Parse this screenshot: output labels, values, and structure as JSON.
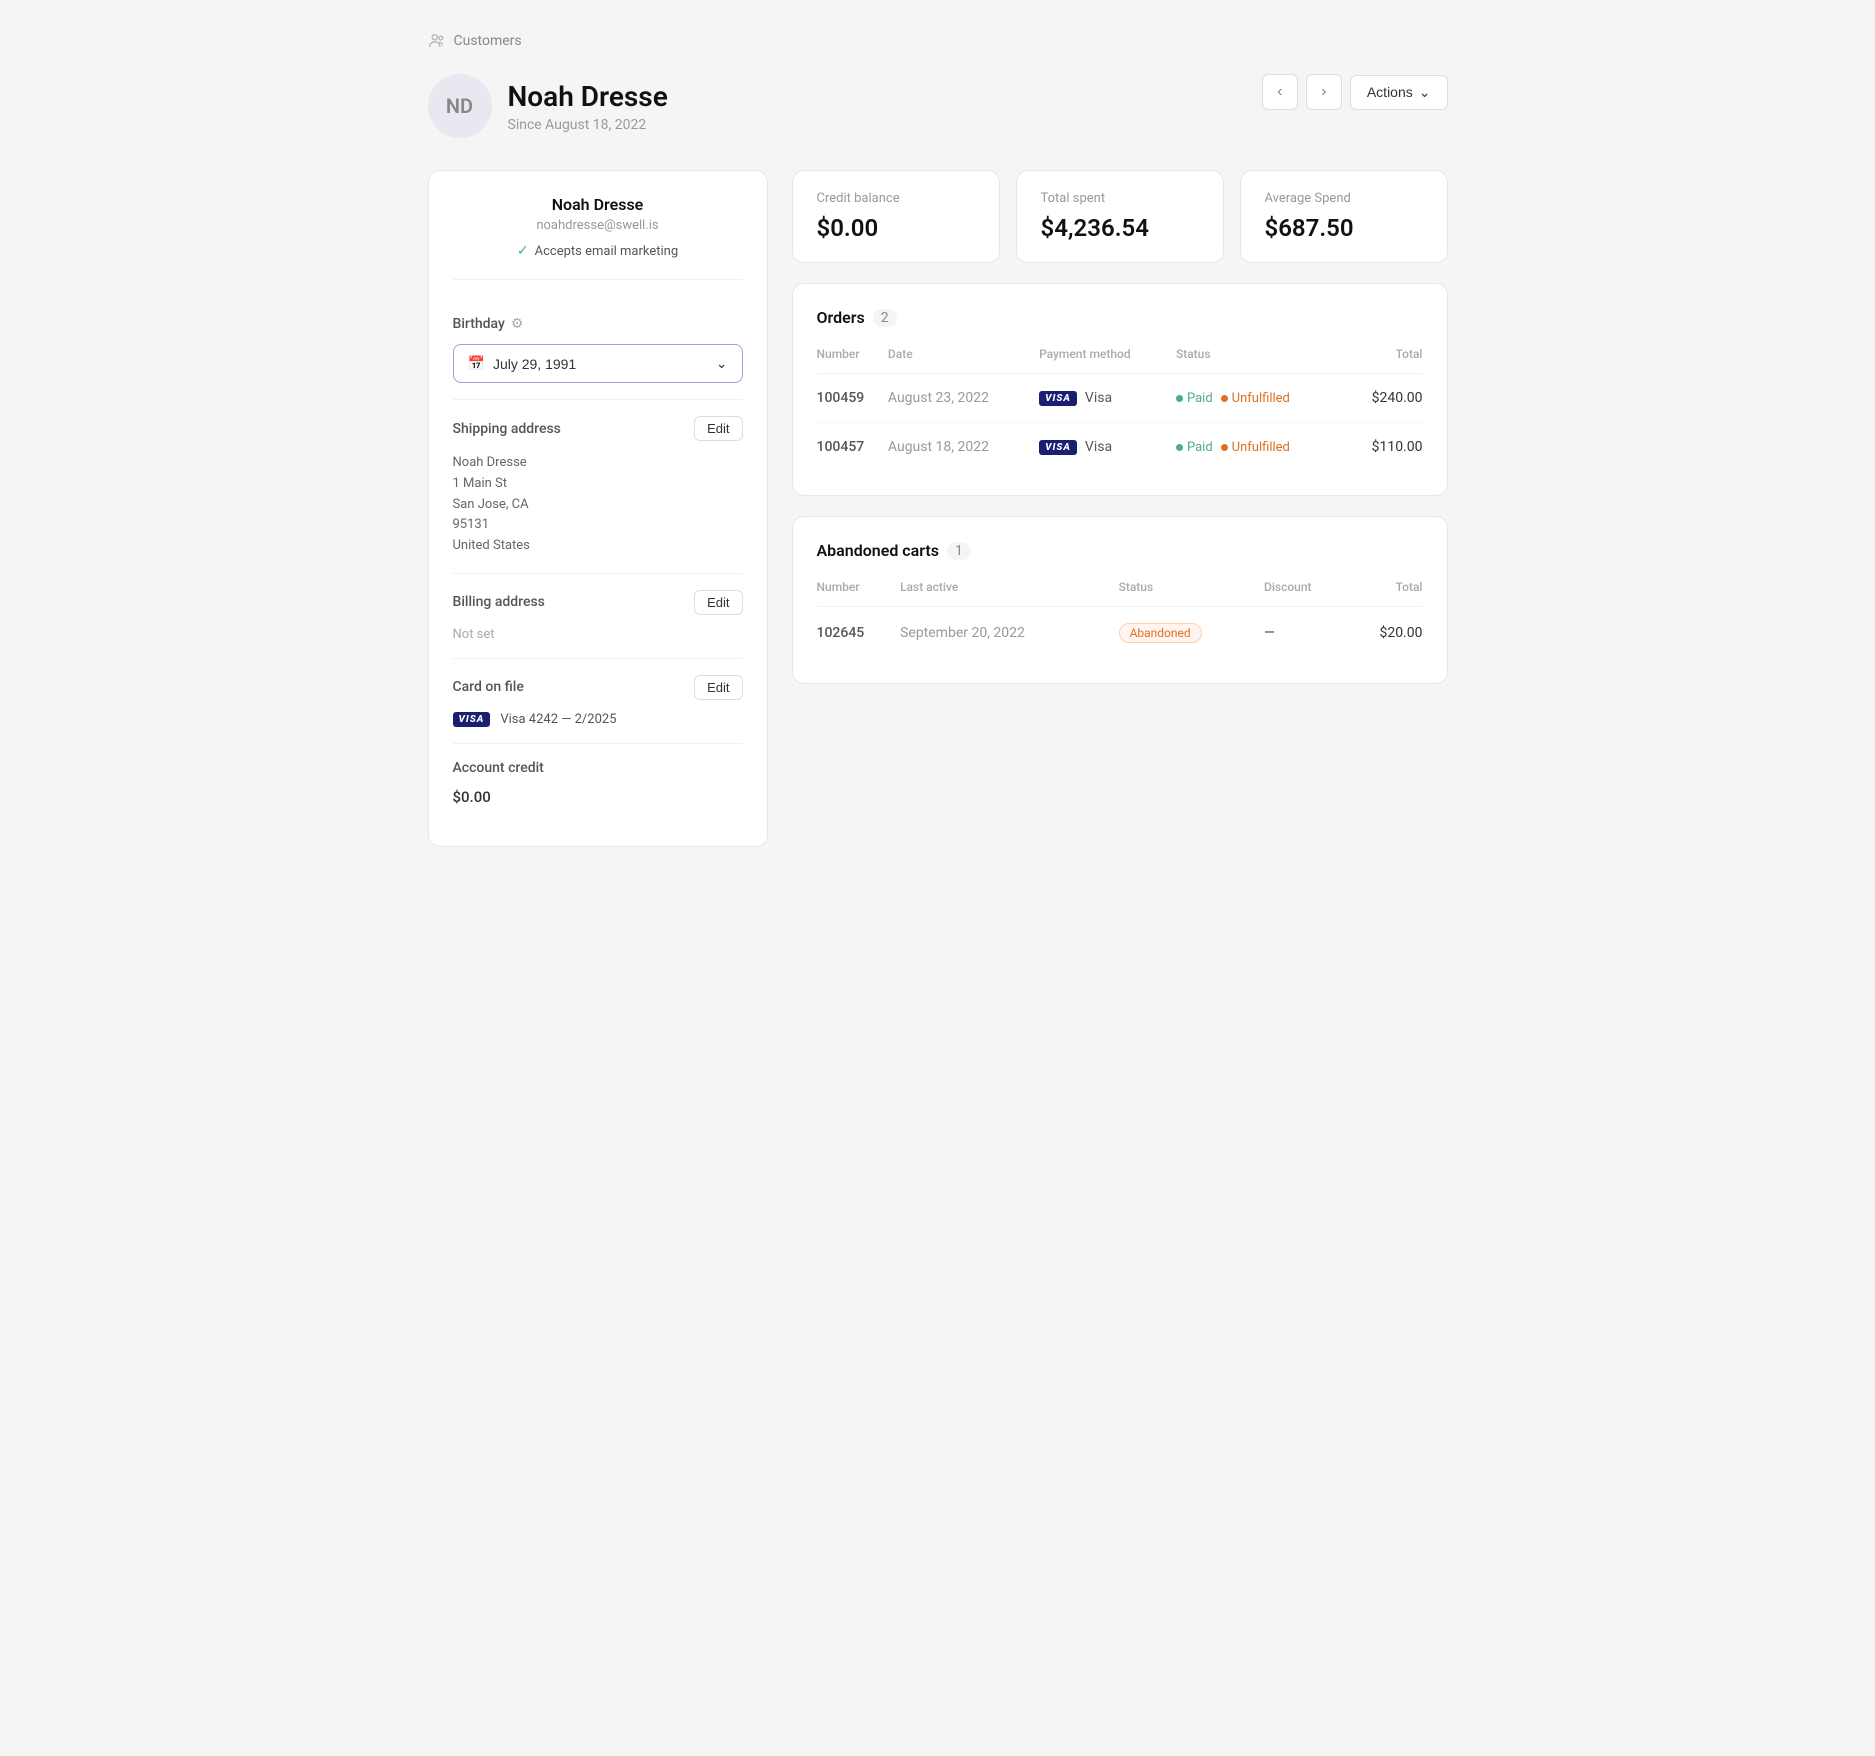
{
  "breadcrumb": {
    "label": "Customers"
  },
  "header": {
    "avatar_initials": "ND",
    "customer_name": "Noah Dresse",
    "since": "Since August 18, 2022",
    "nav_prev": "‹",
    "nav_next": "›",
    "actions_label": "Actions"
  },
  "customer_card": {
    "name": "Noah Dresse",
    "email": "noahdresse@swell.is",
    "email_marketing": "Accepts email marketing",
    "birthday_label": "Birthday",
    "birthday_value": "July 29, 1991",
    "shipping_address": {
      "label": "Shipping address",
      "edit_label": "Edit",
      "line1": "Noah Dresse",
      "line2": "1 Main St",
      "line3": "San Jose, CA",
      "line4": "95131",
      "line5": "United States"
    },
    "billing_address": {
      "label": "Billing address",
      "edit_label": "Edit",
      "value": "Not set"
    },
    "card_on_file": {
      "label": "Card on file",
      "edit_label": "Edit",
      "card_text": "Visa 4242 — 2/2025"
    },
    "account_credit": {
      "label": "Account credit",
      "value": "$0.00"
    }
  },
  "stats": {
    "credit_balance": {
      "label": "Credit balance",
      "value": "$0.00"
    },
    "total_spent": {
      "label": "Total spent",
      "value": "$4,236.54"
    },
    "average_spend": {
      "label": "Average Spend",
      "value": "$687.50"
    }
  },
  "orders": {
    "title": "Orders",
    "count": "2",
    "columns": [
      "Number",
      "Date",
      "Payment method",
      "Status",
      "Total"
    ],
    "rows": [
      {
        "number": "100459",
        "date": "August 23, 2022",
        "payment": "Visa",
        "status_paid": "Paid",
        "status_fulfillment": "Unfulfilled",
        "total": "$240.00"
      },
      {
        "number": "100457",
        "date": "August 18, 2022",
        "payment": "Visa",
        "status_paid": "Paid",
        "status_fulfillment": "Unfulfilled",
        "total": "$110.00"
      }
    ]
  },
  "abandoned_carts": {
    "title": "Abandoned carts",
    "count": "1",
    "columns": [
      "Number",
      "Last active",
      "Status",
      "Discount",
      "Total"
    ],
    "rows": [
      {
        "number": "102645",
        "last_active": "September 20, 2022",
        "status": "Abandoned",
        "discount": "—",
        "total": "$20.00"
      }
    ]
  }
}
